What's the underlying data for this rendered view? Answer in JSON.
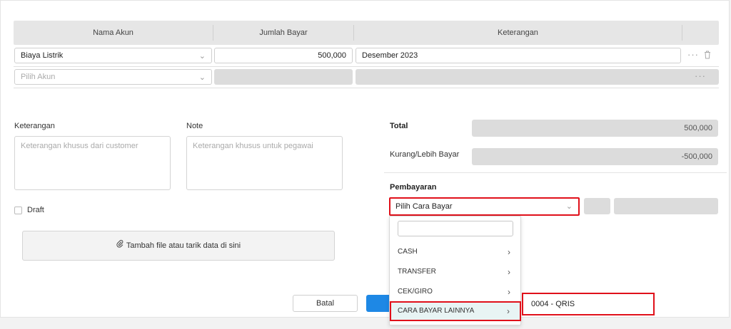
{
  "table": {
    "headers": [
      "Nama Akun",
      "Jumlah Bayar",
      "Keterangan"
    ],
    "rows": [
      {
        "account": "Biaya Listrik",
        "amount": "500,000",
        "description": "Desember 2023"
      },
      {
        "account_placeholder": "Pilih Akun"
      }
    ],
    "more_icon": "ellipsis-icon",
    "delete_icon": "trash-icon"
  },
  "form": {
    "keterangan_label": "Keterangan",
    "keterangan_placeholder": "Keterangan khusus dari customer",
    "note_label": "Note",
    "note_placeholder": "Keterangan khusus untuk pegawai",
    "draft_label": "Draft",
    "upload_label": "Tambah file atau tarik data di sini"
  },
  "summary": {
    "total_label": "Total",
    "total_value": "500,000",
    "balance_label": "Kurang/Lebih Bayar",
    "balance_value": "-500,000",
    "payment_label": "Pembayaran",
    "payment_select": "Pilih Cara Bayar"
  },
  "dropdown": {
    "items": [
      {
        "label": "CASH"
      },
      {
        "label": "TRANSFER"
      },
      {
        "label": "CEK/GIRO"
      },
      {
        "label": "CARA BAYAR LAINNYA"
      }
    ],
    "submenu_item": "0004 - QRIS"
  },
  "actions": {
    "cancel_label": "Batal"
  },
  "colors": {
    "highlight_red": "#e0101a",
    "primary_blue": "#1e88e5"
  }
}
